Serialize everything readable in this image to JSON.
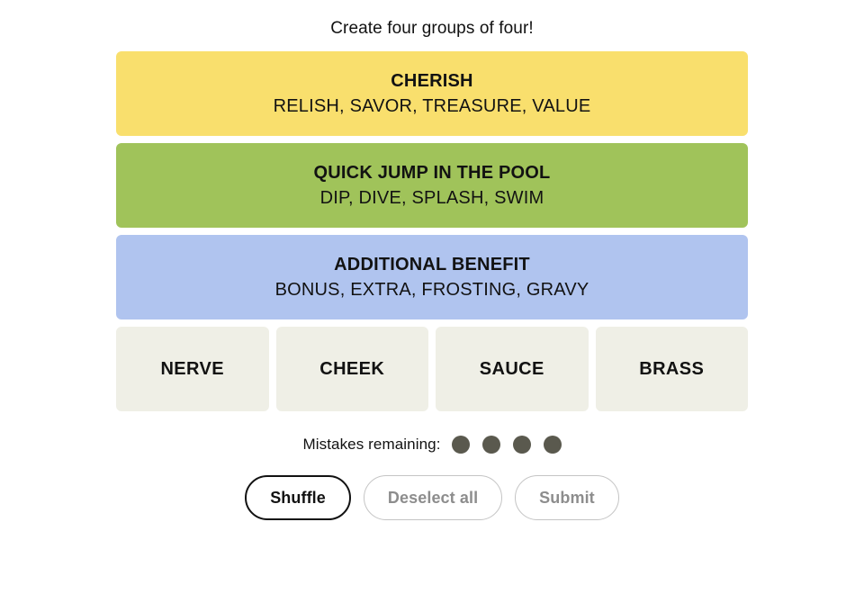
{
  "instruction": "Create four groups of four!",
  "colors": {
    "yellow": "#f9df6d",
    "green": "#a0c35a",
    "blue": "#b0c4ef",
    "purple": "#ba81c5",
    "tile": "#efefe6",
    "dot": "#5a594e",
    "text": "#121212",
    "disabled_text": "#8d8d8d",
    "disabled_border": "#c4c4c4"
  },
  "solved_groups": [
    {
      "title": "CHERISH",
      "members": "RELISH, SAVOR, TREASURE, VALUE",
      "color": "#f9df6d",
      "color_name": "yellow"
    },
    {
      "title": "QUICK JUMP IN THE POOL",
      "members": "DIP, DIVE, SPLASH, SWIM",
      "color": "#a0c35a",
      "color_name": "green"
    },
    {
      "title": "ADDITIONAL BENEFIT",
      "members": "BONUS, EXTRA, FROSTING, GRAVY",
      "color": "#b0c4ef",
      "color_name": "blue"
    }
  ],
  "tiles": [
    {
      "label": "NERVE",
      "selected": false
    },
    {
      "label": "CHEEK",
      "selected": false
    },
    {
      "label": "SAUCE",
      "selected": false
    },
    {
      "label": "BRASS",
      "selected": false
    }
  ],
  "mistakes": {
    "label": "Mistakes remaining:",
    "remaining": 4,
    "dots": [
      1,
      2,
      3,
      4
    ]
  },
  "buttons": [
    {
      "label": "Shuffle",
      "state": "active"
    },
    {
      "label": "Deselect all",
      "state": "disabled"
    },
    {
      "label": "Submit",
      "state": "disabled"
    }
  ]
}
